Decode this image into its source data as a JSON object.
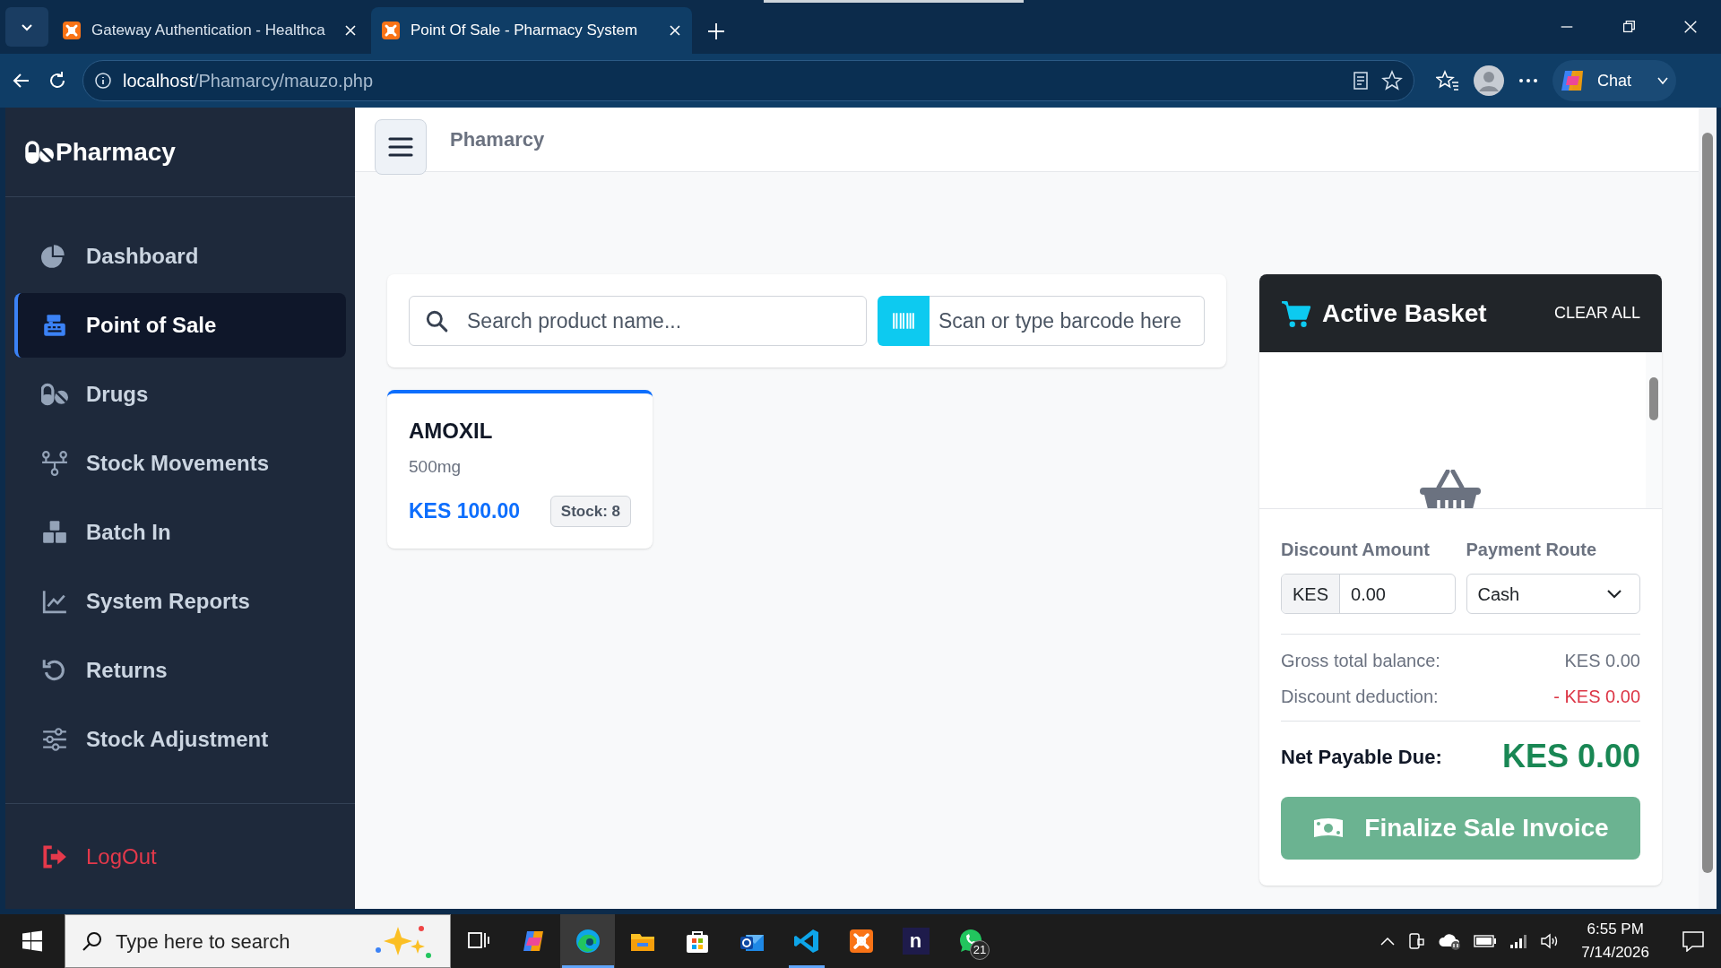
{
  "browser": {
    "tabs": [
      {
        "title": "Gateway Authentication - Healthca",
        "selected": false
      },
      {
        "title": "Point Of Sale - Pharmacy System",
        "selected": true
      }
    ],
    "address": {
      "host": "localhost",
      "path": "/Phamarcy/mauzo.php"
    },
    "chat": "Chat"
  },
  "sidebar": {
    "brand": "Pharmacy",
    "items": [
      {
        "label": "Dashboard",
        "kind": "pie",
        "selected": false
      },
      {
        "label": "Point of Sale",
        "kind": "register",
        "selected": true
      },
      {
        "label": "Drugs",
        "kind": "pills",
        "selected": false
      },
      {
        "label": "Stock Movements",
        "kind": "tree",
        "selected": false
      },
      {
        "label": "Batch In",
        "kind": "boxes",
        "selected": false
      },
      {
        "label": "System Reports",
        "kind": "line",
        "selected": false
      },
      {
        "label": "Returns",
        "kind": "undo",
        "selected": false
      },
      {
        "label": "Stock Adjustment",
        "kind": "sliders",
        "selected": false
      }
    ],
    "logout": "LogOut"
  },
  "header": {
    "title": "Phamarcy"
  },
  "search": {
    "placeholder": "Search product name...",
    "barcode_placeholder": "Scan or type barcode here"
  },
  "products": [
    {
      "name": "AMOXIL",
      "strength": "500mg",
      "price": "KES 100.00",
      "stock": "Stock: 8"
    }
  ],
  "basket": {
    "title": "Active Basket",
    "clear": "CLEAR ALL",
    "discount_label": "Discount Amount",
    "currency": "KES",
    "discount_value": "0.00",
    "payment_label": "Payment Route",
    "payment_value": "Cash",
    "gross_label": "Gross total balance:",
    "gross_value": "KES 0.00",
    "deduction_label": "Discount deduction:",
    "deduction_value": "- KES 0.00",
    "net_label": "Net Payable Due:",
    "net_value": "KES 0.00",
    "finalize": "Finalize Sale Invoice"
  },
  "taskbar": {
    "search_placeholder": "Type here to search",
    "apps": [
      {
        "kind": "taskview",
        "selected": false,
        "running": false
      },
      {
        "kind": "copilot",
        "selected": false,
        "running": false
      },
      {
        "kind": "edge",
        "selected": true,
        "running": true
      },
      {
        "kind": "explorer",
        "selected": false,
        "running": false
      },
      {
        "kind": "store",
        "selected": false,
        "running": false
      },
      {
        "kind": "outlook",
        "selected": false,
        "running": false
      },
      {
        "kind": "vscode",
        "selected": false,
        "running": true
      },
      {
        "kind": "xampp",
        "selected": false,
        "running": false
      },
      {
        "kind": "notion",
        "selected": false,
        "running": false,
        "glyph": "n"
      },
      {
        "kind": "whatsapp",
        "selected": false,
        "running": false,
        "badge": "21"
      }
    ],
    "time": "6:55 PM",
    "date": "7/14/2026"
  }
}
